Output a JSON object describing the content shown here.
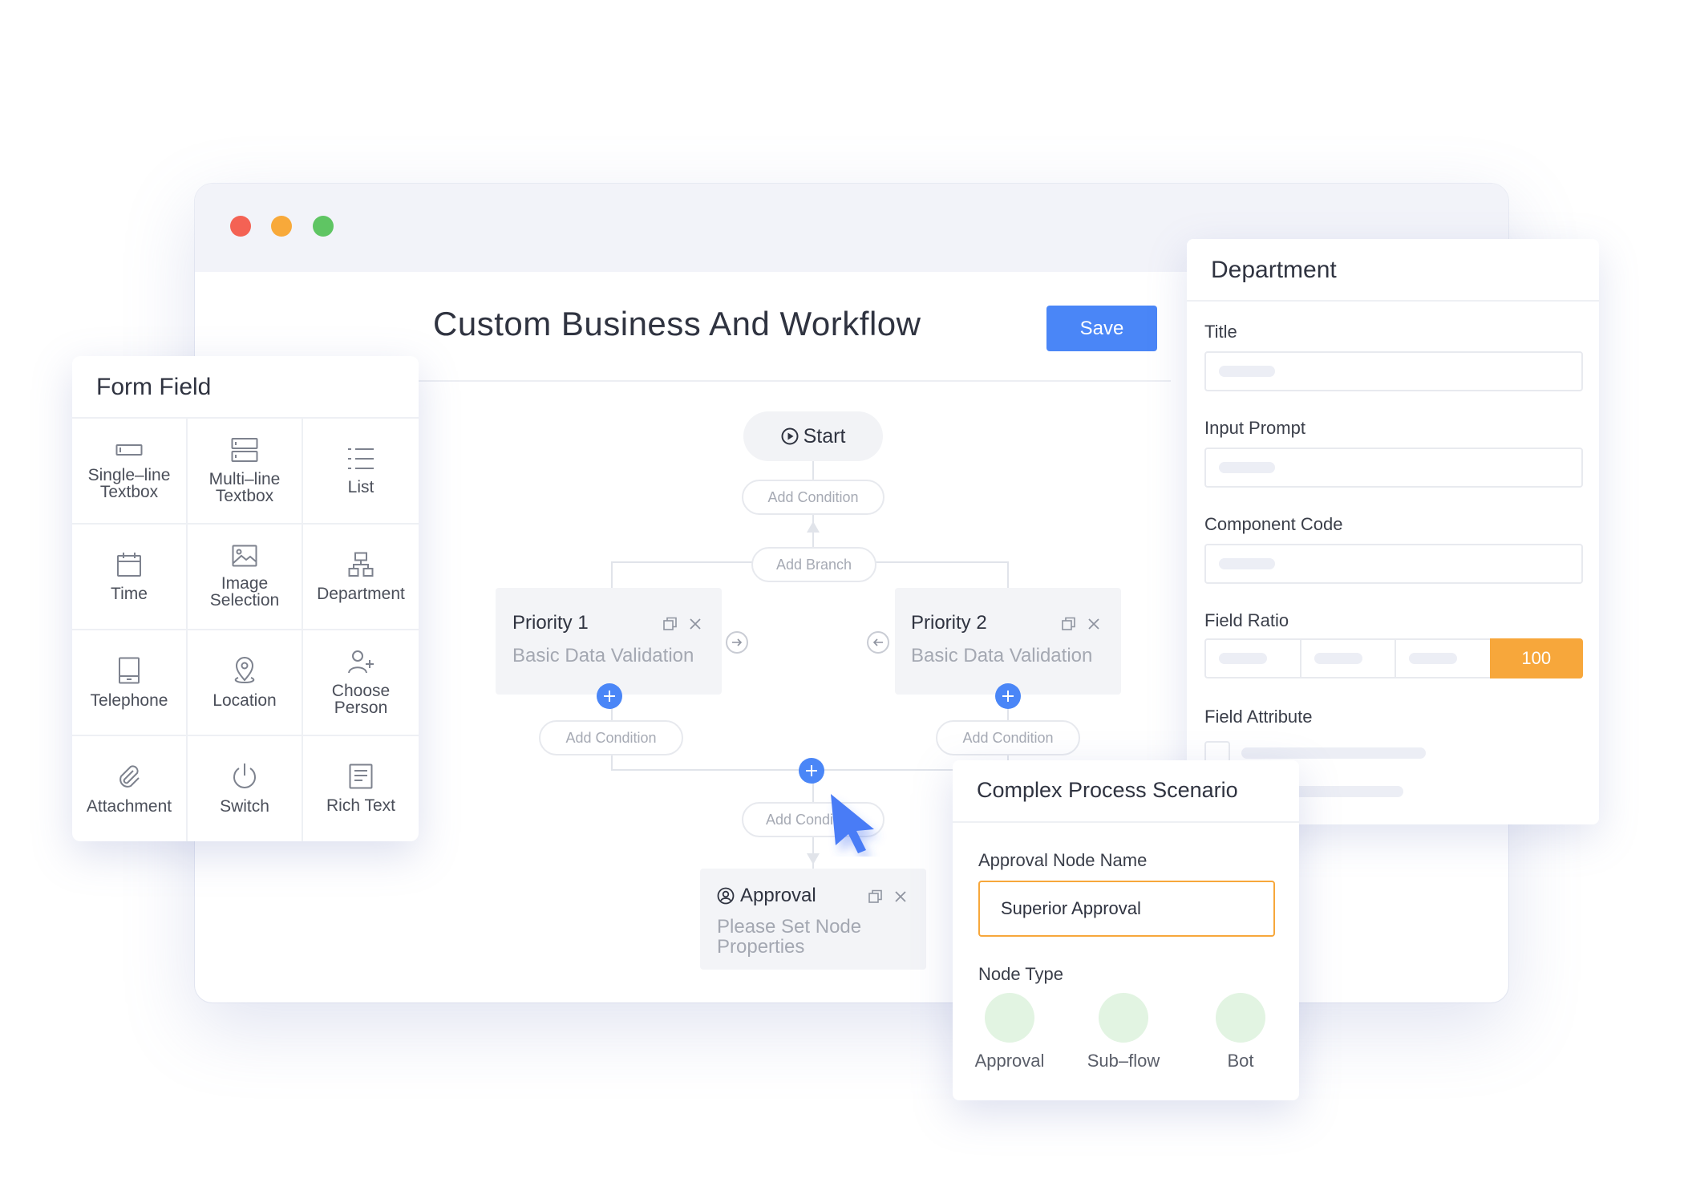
{
  "window": {
    "title": "Custom Business And Workflow",
    "save_label": "Save"
  },
  "flow": {
    "start_label": "Start",
    "add_condition": "Add Condition",
    "add_branch": "Add Branch",
    "add_condition_partial": "Add Condi",
    "branches": [
      {
        "title": "Priority 1",
        "subtitle": "Basic Data Validation"
      },
      {
        "title": "Priority 2",
        "subtitle": "Basic Data Validation"
      }
    ],
    "approval_node": {
      "title": "Approval",
      "subtitle": "Please Set Node Properties"
    }
  },
  "form_field": {
    "title": "Form Field",
    "items": [
      {
        "label": "Single–line Textbox",
        "icon": "single-line-textbox-icon"
      },
      {
        "label": "Multi–line Textbox",
        "icon": "multi-line-textbox-icon"
      },
      {
        "label": "List",
        "icon": "list-icon"
      },
      {
        "label": "Time",
        "icon": "calendar-icon"
      },
      {
        "label": "Image Selection",
        "icon": "image-icon"
      },
      {
        "label": "Department",
        "icon": "org-chart-icon"
      },
      {
        "label": "Telephone",
        "icon": "telephone-icon"
      },
      {
        "label": "Location",
        "icon": "location-pin-icon"
      },
      {
        "label": "Choose Person",
        "icon": "add-person-icon"
      },
      {
        "label": "Attachment",
        "icon": "paperclip-icon"
      },
      {
        "label": "Switch",
        "icon": "power-icon"
      },
      {
        "label": "Rich Text",
        "icon": "document-icon"
      }
    ]
  },
  "department_panel": {
    "title": "Department",
    "fields": [
      "Title",
      "Input Prompt",
      "Component Code",
      "Field Ratio",
      "Field Attribute"
    ],
    "ratio_value": "100",
    "accent": "#f7a73b"
  },
  "scenario_panel": {
    "title": "Complex Process Scenario",
    "node_name_label": "Approval Node Name",
    "node_name_value": "Superior Approval",
    "node_type_label": "Node Type",
    "node_types": [
      "Approval",
      "Sub–flow",
      "Bot"
    ]
  },
  "colors": {
    "primary": "#4a86f7",
    "orange": "#f7a73b",
    "green_soft": "#e2f4e2"
  }
}
